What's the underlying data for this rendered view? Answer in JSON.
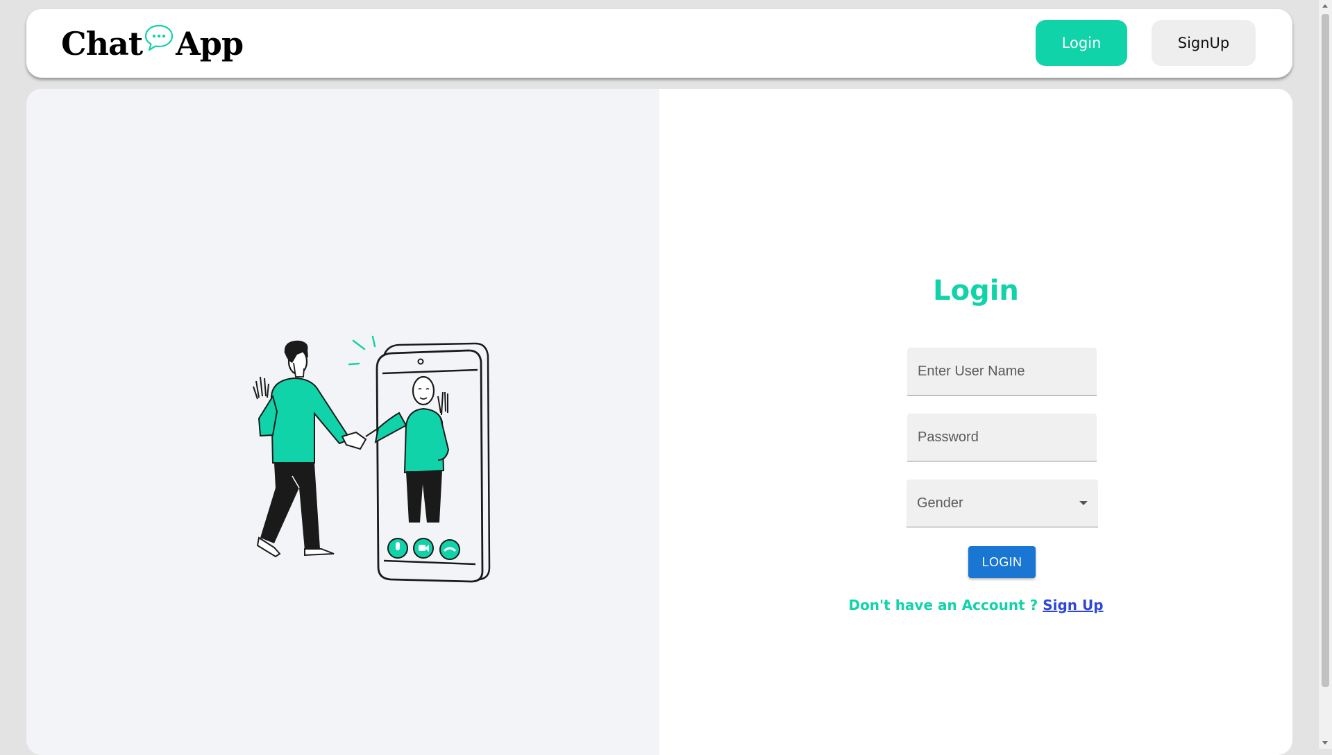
{
  "brand": {
    "name_part1": "Chat",
    "name_part2": "App",
    "accent_color": "#10d3a9"
  },
  "navbar": {
    "login_label": "Login",
    "signup_label": "SignUp"
  },
  "illustration": {
    "icon": "video-call-handshake-illustration"
  },
  "login_form": {
    "title": "Login",
    "username_placeholder": "Enter User Name",
    "password_placeholder": "Password",
    "gender_placeholder": "Gender",
    "submit_label": "LOGIN",
    "no_account_text": "Don't have an Account ? ",
    "signup_link": "Sign Up",
    "submit_color": "#1976d2",
    "link_color": "#2f47d6"
  }
}
